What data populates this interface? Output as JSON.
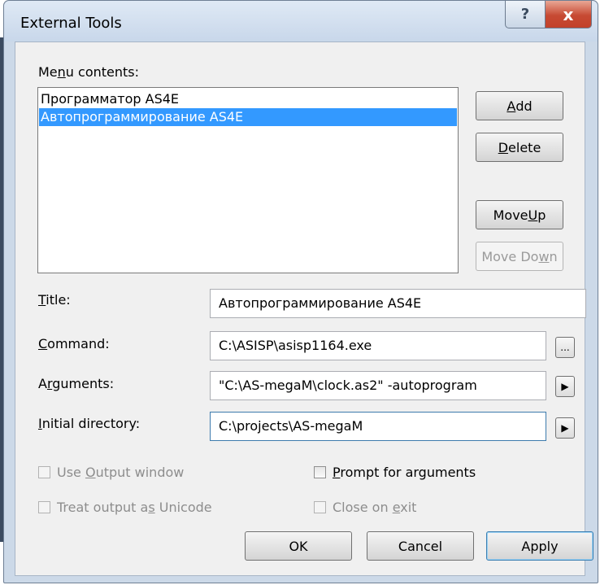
{
  "window": {
    "title": "External Tools",
    "help_label": "?",
    "close_label": "x"
  },
  "menu_contents": {
    "label_pre": "Me",
    "label_key": "n",
    "label_post": "u contents:",
    "items": [
      {
        "label": "Программатор AS4E",
        "selected": false
      },
      {
        "label": "Автопрограммирование AS4E",
        "selected": true
      }
    ]
  },
  "side_buttons": {
    "add": {
      "pre": "",
      "key": "A",
      "post": "dd"
    },
    "delete": {
      "pre": "",
      "key": "D",
      "post": "elete"
    },
    "move_up": {
      "pre": "Move ",
      "key": "U",
      "post": "p"
    },
    "move_down": {
      "pre": "Move Do",
      "key": "w",
      "post": "n"
    }
  },
  "fields": {
    "title": {
      "label_pre": "",
      "label_key": "T",
      "label_post": "itle:",
      "value": "Автопрограммирование AS4E"
    },
    "command": {
      "label_pre": "",
      "label_key": "C",
      "label_post": "ommand:",
      "value": "C:\\ASISP\\asisp1164.exe",
      "browse_label": "..."
    },
    "arguments": {
      "label_pre": "A",
      "label_key": "r",
      "label_post": "guments:",
      "value": "\"C:\\AS-megaM\\clock.as2\" -autoprogram",
      "arrow": "▶"
    },
    "initial_directory": {
      "label_pre": "",
      "label_key": "I",
      "label_post": "nitial directory:",
      "value": "C:\\projects\\AS-megaM",
      "arrow": "▶"
    }
  },
  "checkboxes": {
    "use_output": {
      "pre": "Use ",
      "key": "O",
      "post": "utput window",
      "checked": false,
      "enabled": false
    },
    "prompt_args": {
      "pre": "",
      "key": "P",
      "post": "rompt for arguments",
      "checked": false,
      "enabled": true
    },
    "treat_unicode": {
      "pre": "Treat output a",
      "key": "s",
      "post": " Unicode",
      "checked": false,
      "enabled": false
    },
    "close_on_exit": {
      "pre": "Close on ",
      "key": "e",
      "post": "xit",
      "checked": false,
      "enabled": false
    }
  },
  "footer": {
    "ok": "OK",
    "cancel": "Cancel",
    "apply": "Apply"
  }
}
